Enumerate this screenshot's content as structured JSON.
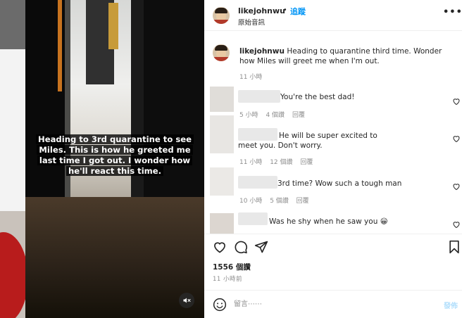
{
  "video": {
    "caption": "Heading to 3rd quarantine to see Miles. This is how he greeted me last time I got out. I wonder how he'll react this time.",
    "mute_icon": "muted-speaker-icon"
  },
  "header": {
    "username": "likejohnwu",
    "separator": "•",
    "follow_label": "追蹤",
    "subtitle": "原始音訊",
    "more_icon": "more-options-icon"
  },
  "post_caption": {
    "username": "likejohnwu",
    "text": "Heading to quarantine third time. Wonder how Miles will greet me when I'm out.",
    "time": "11 小時"
  },
  "comments": [
    {
      "text": "You're the best dad!",
      "time": "5 小時",
      "likes": "4 個讚",
      "reply": "回覆"
    },
    {
      "text": "He will be super excited to meet you. Don't worry.",
      "time": "11 小時",
      "likes": "12 個讚",
      "reply": "回覆"
    },
    {
      "text": "3rd time? Wow such a tough man",
      "time": "10 小時",
      "likes": "5 個讚",
      "reply": "回覆"
    },
    {
      "text": "Was he shy when he saw you 😀"
    }
  ],
  "actions": {
    "like_icon": "heart-icon",
    "comment_icon": "comment-bubble-icon",
    "share_icon": "paper-plane-icon",
    "save_icon": "bookmark-icon"
  },
  "likes_count": "1556 個讚",
  "posted_time": "11 小時前",
  "comment_box": {
    "placeholder": "留言⋯⋯",
    "post_label": "發佈"
  },
  "colors": {
    "accent": "#0095f6",
    "post_disabled": "#b2dffc",
    "muted_text": "#8e8e8e"
  }
}
